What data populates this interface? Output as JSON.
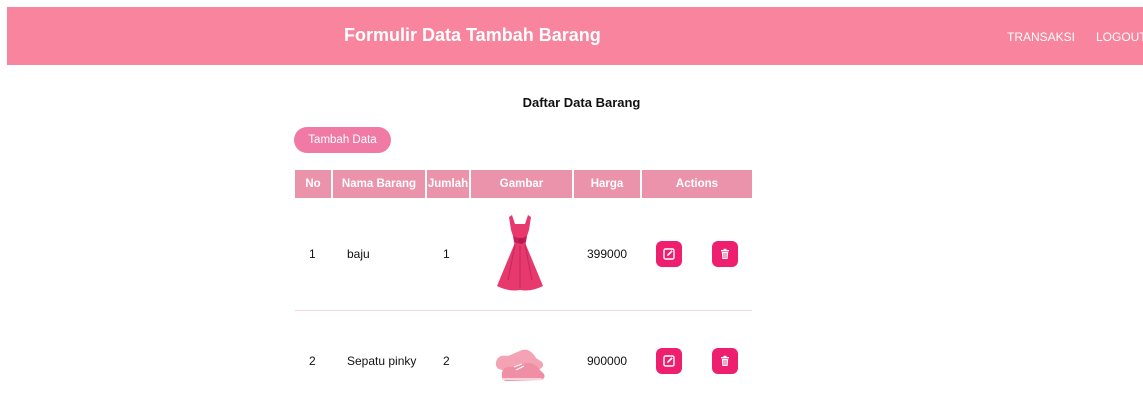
{
  "header": {
    "title": "Formulir Data Tambah Barang",
    "nav": [
      {
        "label": "TRANSAKSI"
      },
      {
        "label": "LOGOUT"
      }
    ]
  },
  "main": {
    "heading": "Daftar Data Barang",
    "add_button": "Tambah Data",
    "table": {
      "columns": [
        "No",
        "Nama Barang",
        "Jumlah",
        "Gambar",
        "Harga",
        "Actions"
      ],
      "rows": [
        {
          "no": "1",
          "nama": "baju",
          "jumlah": "1",
          "gambar": "pink-dress-image",
          "harga": "399000"
        },
        {
          "no": "2",
          "nama": "Sepatu pinky",
          "jumlah": "2",
          "gambar": "pink-shoes-image",
          "harga": "900000"
        }
      ]
    }
  },
  "colors": {
    "header": "#f9849e",
    "table_header": "#ea93aa",
    "button": "#f07aa3",
    "action": "#ee1f6e"
  },
  "icons": [
    "edit-icon",
    "trash-icon"
  ]
}
